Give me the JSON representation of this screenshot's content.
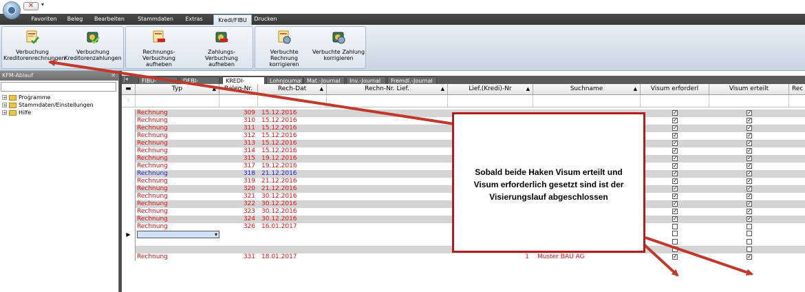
{
  "menu": {
    "tabs": [
      "Favoriten",
      "Beleg",
      "Bearbeiten",
      "Stammdaten",
      "Extras",
      "Kredi/FIBU",
      "Drucken"
    ],
    "active": "Kredi/FIBU"
  },
  "ribbon": {
    "buttons": [
      {
        "line1": "Verbuchung",
        "line2": "Kreditorenrechnungen",
        "icon": "invoice-check-icon"
      },
      {
        "line1": "Verbuchung",
        "line2": "Kreditorenzahlungen",
        "icon": "payment-check-icon"
      },
      {
        "line1": "Rechnungs-Verbuchung",
        "line2": "aufheben",
        "icon": "invoice-cancel-icon"
      },
      {
        "line1": "Zahlungs-Verbuchung",
        "line2": "aufheben",
        "icon": "payment-cancel-icon"
      },
      {
        "line1": "Verbuchte Rechnung",
        "line2": "korrigieren",
        "icon": "invoice-edit-icon"
      },
      {
        "line1": "Verbuchte Zahlung",
        "line2": "korrigieren",
        "icon": "payment-edit-icon"
      }
    ]
  },
  "left_panel": {
    "title": "KFM-Ablauf",
    "tree": [
      "Programme",
      "Stammdaten/Einstellungen",
      "Hilfe"
    ]
  },
  "journal_tabs": [
    "FIBU-Journal",
    "DEBI-Journal",
    "KREDI-Journal",
    "Lohnjournal",
    "Mat.-Journal",
    "Inv.-Journal",
    "Fremdl.-Journal"
  ],
  "active_journal": "KREDI-Journal",
  "columns": [
    "Typ",
    "Beleg-Nr.",
    "Rech-Dat",
    "Rechn-Nr. Lief.",
    "Lief.(Kredi)-Nr",
    "Suchname",
    "Visum erforderl",
    "Visum erteilt",
    "Rec"
  ],
  "rows": [
    {
      "typ": "Rechnung",
      "beleg": "309",
      "datum": "15.12.2016",
      "lief": "",
      "such": "",
      "erf": true,
      "ert": true,
      "color": "#e01010"
    },
    {
      "typ": "Rechnung",
      "beleg": "310",
      "datum": "15.12.2016",
      "lief": "",
      "such": "",
      "erf": true,
      "ert": true,
      "color": "#e01010"
    },
    {
      "typ": "Rechnung",
      "beleg": "311",
      "datum": "15.12.2016",
      "lief": "",
      "such": "",
      "erf": true,
      "ert": true,
      "color": "#e01010"
    },
    {
      "typ": "Rechnung",
      "beleg": "312",
      "datum": "15.12.2016",
      "lief": "",
      "such": "",
      "erf": true,
      "ert": true,
      "color": "#e01010"
    },
    {
      "typ": "Rechnung",
      "beleg": "313",
      "datum": "15.12.2016",
      "lief": "",
      "such": "",
      "erf": true,
      "ert": true,
      "color": "#e01010"
    },
    {
      "typ": "Rechnung",
      "beleg": "314",
      "datum": "15.12.2016",
      "lief": "",
      "such": "",
      "erf": true,
      "ert": true,
      "color": "#e01010"
    },
    {
      "typ": "Rechnung",
      "beleg": "315",
      "datum": "19.12.2016",
      "lief": "",
      "such": "",
      "erf": true,
      "ert": true,
      "color": "#e01010"
    },
    {
      "typ": "Rechnung",
      "beleg": "317",
      "datum": "19.12.2016",
      "lief": "",
      "such": "",
      "erf": true,
      "ert": true,
      "color": "#e01010"
    },
    {
      "typ": "Rechnung",
      "beleg": "318",
      "datum": "21.12.2016",
      "lief": "",
      "such": "",
      "erf": true,
      "ert": true,
      "color": "#1a1ae0"
    },
    {
      "typ": "Rechnung",
      "beleg": "319",
      "datum": "21.12.2016",
      "lief": "",
      "such": "",
      "erf": true,
      "ert": true,
      "color": "#e01010"
    },
    {
      "typ": "Rechnung",
      "beleg": "320",
      "datum": "21.12.2016",
      "lief": "",
      "such": "",
      "erf": true,
      "ert": true,
      "color": "#e01010"
    },
    {
      "typ": "Rechnung",
      "beleg": "321",
      "datum": "30.12.2016",
      "lief": "",
      "such": "",
      "erf": true,
      "ert": true,
      "color": "#e01010"
    },
    {
      "typ": "Rechnung",
      "beleg": "322",
      "datum": "30.12.2016",
      "lief": "",
      "such": "",
      "erf": true,
      "ert": true,
      "color": "#e01010"
    },
    {
      "typ": "Rechnung",
      "beleg": "323",
      "datum": "30.12.2016",
      "lief": "",
      "such": "",
      "erf": true,
      "ert": true,
      "color": "#e01010"
    },
    {
      "typ": "Rechnung",
      "beleg": "324",
      "datum": "30.12.2016",
      "lief": "",
      "such": "",
      "erf": true,
      "ert": true,
      "color": "#e01010"
    },
    {
      "typ": "Rechnung",
      "beleg": "326",
      "datum": "16.01.2017",
      "lief": "",
      "such": "",
      "erf": false,
      "ert": false,
      "color": "#e01010"
    },
    {
      "typ": "",
      "beleg": "",
      "datum": "",
      "lief": "",
      "such": "",
      "erf": false,
      "ert": false,
      "color": "#000000",
      "editing": true
    },
    {
      "typ": "",
      "beleg": "",
      "datum": "",
      "lief": "",
      "such": "",
      "erf": false,
      "ert": false,
      "color": "#000000"
    },
    {
      "typ": "",
      "beleg": "",
      "datum": "",
      "lief": "",
      "such": "",
      "erf": false,
      "ert": false,
      "color": "#000000"
    },
    {
      "typ": "Rechnung",
      "beleg": "331",
      "datum": "18.01.2017",
      "lief": "1",
      "such": "Muster BAU AG",
      "erf": true,
      "ert": true,
      "color": "#e01010"
    }
  ],
  "callout": {
    "line1": "Sobald beide Haken Visum erteilt und",
    "line2": "Visum erforderlich gesetzt sind ist der",
    "line3": "Visierungslauf abgeschlossen"
  },
  "colors": {
    "arrow": "#c0392b",
    "callout_border": "#b31c1c",
    "row_alt": "#d4d4d4"
  }
}
